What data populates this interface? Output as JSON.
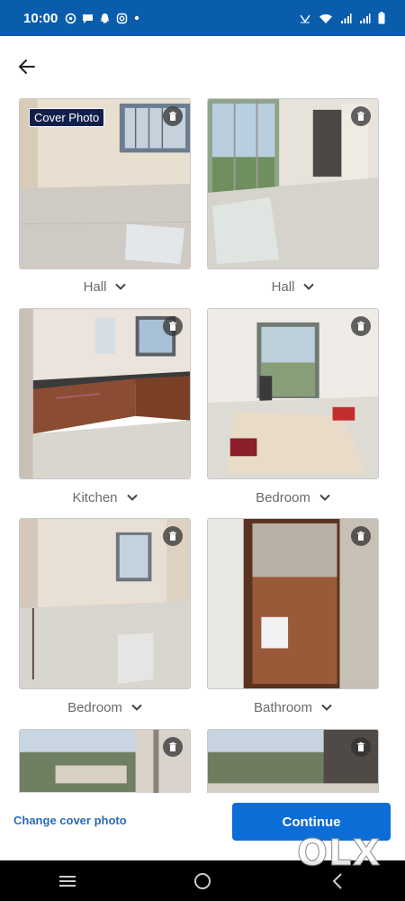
{
  "status_bar": {
    "time": "10:00",
    "left_icons": [
      "whatsapp-icon",
      "chat-icon",
      "snapchat-icon",
      "instagram-icon",
      "dot-icon"
    ],
    "right_icons": [
      "volte-icon",
      "wifi-icon",
      "signal-icon",
      "signal-icon",
      "battery-icon"
    ],
    "background": "#0a5cad"
  },
  "photos": [
    {
      "room": "Hall",
      "cover": true,
      "badge": "Cover Photo"
    },
    {
      "room": "Hall",
      "cover": false
    },
    {
      "room": "Kitchen",
      "cover": false
    },
    {
      "room": "Bedroom",
      "cover": false
    },
    {
      "room": "Bedroom",
      "cover": false
    },
    {
      "room": "Bathroom",
      "cover": false
    },
    {
      "room": "",
      "cover": false
    },
    {
      "room": "",
      "cover": false
    }
  ],
  "footer": {
    "change_cover": "Change cover photo",
    "continue": "Continue",
    "accent": "#0b6dd6"
  },
  "watermark": "OLX"
}
